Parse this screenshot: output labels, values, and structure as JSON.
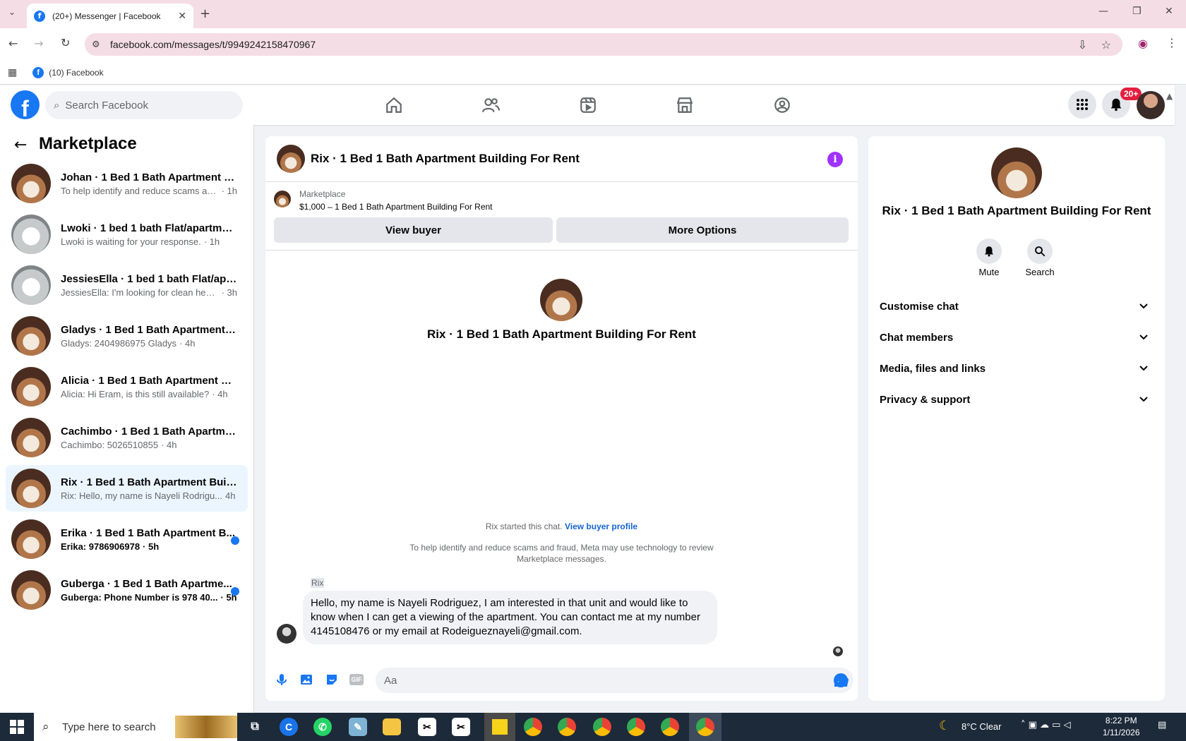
{
  "browser": {
    "tab_title": "(20+) Messenger | Facebook",
    "url": "facebook.com/messages/t/9949242158470967",
    "bookmark": "(10) Facebook"
  },
  "header": {
    "search_placeholder": "Search Facebook",
    "notif_badge": "20+"
  },
  "sidebar": {
    "title": "Marketplace",
    "conversations": [
      {
        "name": "Johan · 1 Bed 1 Bath Apartment Bu...",
        "preview": "To help identify and reduce scams an...",
        "time": "· 1h",
        "unread": false,
        "thumb": "bedroom"
      },
      {
        "name": "Lwoki · 1 bed 1 bath Flat/apartment",
        "preview": "Lwoki is waiting for your response.",
        "time": "· 1h",
        "unread": false,
        "thumb": "white"
      },
      {
        "name": "JessiesElla · 1 bed 1 bath Flat/apart...",
        "preview": "JessiesElla: I'm looking for clean healt...",
        "time": "· 3h",
        "unread": false,
        "thumb": "white"
      },
      {
        "name": "Gladys · 1 Bed 1 Bath Apartment B...",
        "preview": "Gladys: 2404986975 Gladys",
        "time": "· 4h",
        "unread": false,
        "thumb": "bedroom"
      },
      {
        "name": "Alicia · 1 Bed 1 Bath Apartment Bui...",
        "preview": "Alicia: Hi Eram, is this still available?",
        "time": "· 4h",
        "unread": false,
        "thumb": "bedroom"
      },
      {
        "name": "Cachimbo · 1 Bed 1 Bath Apartmen...",
        "preview": "Cachimbo: 5026510855",
        "time": "· 4h",
        "unread": false,
        "thumb": "bedroom"
      },
      {
        "name": "Rix · 1 Bed 1 Bath Apartment Buildi...",
        "preview": "Rix: Hello, my name is Nayeli Rodrigu...",
        "time": "4h",
        "unread": false,
        "thumb": "bedroom",
        "active": true
      },
      {
        "name": "Erika · 1 Bed 1 Bath Apartment B...",
        "preview": "Erika: 9786906978",
        "time": "· 5h",
        "unread": true,
        "thumb": "bedroom"
      },
      {
        "name": "Guberga · 1 Bed 1 Bath Apartme...",
        "preview": "Guberga: Phone Number is 978 40...",
        "time": "· 5h",
        "unread": true,
        "thumb": "bedroom"
      }
    ]
  },
  "chat": {
    "title": "Rix · 1 Bed 1 Bath Apartment Building For Rent",
    "marketplace_label": "Marketplace",
    "listing": "$1,000 – 1 Bed 1 Bath Apartment Building For Rent",
    "view_buyer": "View buyer",
    "more_options": "More Options",
    "intro_title": "Rix · 1 Bed 1 Bath Apartment Building For Rent",
    "started": "Rix started this chat.",
    "view_buyer_profile": "View buyer profile",
    "notice_line1": "To help identify and reduce scams and fraud, Meta may use technology to review",
    "notice_line2": "Marketplace messages.",
    "sender": "Rix",
    "message_line1": "Hello, my name is Nayeli Rodriguez, I am interested in that unit and would like to",
    "message_line2": "know when I can get a viewing of the apartment. You can contact me at my number",
    "message_line3": "4145108476 or my email at Rodeigueznayeli@gmail.com.",
    "composer_placeholder": "Aa"
  },
  "details": {
    "title": "Rix · 1 Bed 1 Bath Apartment Building For Rent",
    "mute": "Mute",
    "search": "Search",
    "sections": [
      "Customise chat",
      "Chat members",
      "Media, files and links",
      "Privacy & support"
    ]
  },
  "taskbar": {
    "search_placeholder": "Type here to search",
    "weather": "8°C  Clear",
    "time": "8:22 PM",
    "date": "1/11/2026"
  },
  "colors": {
    "fb_blue": "#1877f2",
    "accent_purple": "#a033ff",
    "active_row": "#ebf5ff"
  }
}
